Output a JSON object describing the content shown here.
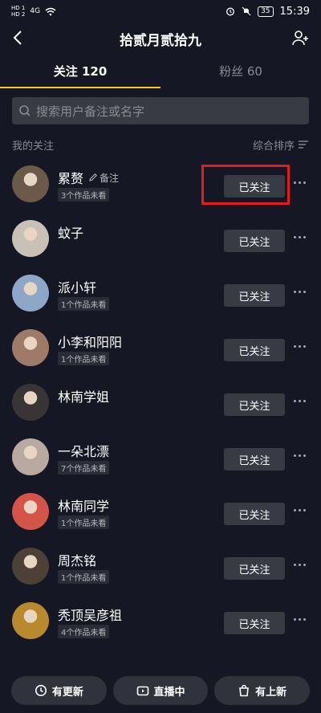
{
  "status_bar": {
    "sim1": "HD 1",
    "sim2": "HD 2",
    "network": "4G",
    "battery": "35",
    "time": "15:39"
  },
  "header": {
    "title": "拾贰月贰拾九"
  },
  "tabs": [
    {
      "label": "关注 120",
      "active": true
    },
    {
      "label": "粉丝 60",
      "active": false
    }
  ],
  "search": {
    "placeholder": "搜索用户备注或名字"
  },
  "section": {
    "title": "我的关注",
    "sort_label": "综合排序"
  },
  "follow_label": "已关注",
  "remark_label": "备注",
  "users": [
    {
      "name": "累赘",
      "badge": "3个作品未看",
      "avatar_color": "#6b5a4a",
      "show_remark": true
    },
    {
      "name": "蚊子",
      "badge": "",
      "avatar_color": "#c9c1b6",
      "show_remark": false
    },
    {
      "name": "派小轩",
      "badge": "1个作品未看",
      "avatar_color": "#8ea6c8",
      "show_remark": false
    },
    {
      "name": "小李和阳阳",
      "badge": "1个作品未看",
      "avatar_color": "#9d7b68",
      "show_remark": false
    },
    {
      "name": "林南学姐",
      "badge": "",
      "avatar_color": "#3a3535",
      "show_remark": false
    },
    {
      "name": "一朵北漂",
      "badge": "7个作品未看",
      "avatar_color": "#b8aaa0",
      "show_remark": false
    },
    {
      "name": "林南同学",
      "badge": "1个作品未看",
      "avatar_color": "#d4544a",
      "show_remark": false
    },
    {
      "name": "周杰铭",
      "badge": "1个作品未看",
      "avatar_color": "#4d4037",
      "show_remark": false
    },
    {
      "name": "秃顶吴彦祖",
      "badge": "4个作品未看",
      "avatar_color": "#b98a2d",
      "show_remark": false
    }
  ],
  "bottom": {
    "updates_label": "有更新",
    "live_label": "直播中",
    "new_label": "有上新"
  },
  "colors": {
    "accent": "#f9c914",
    "highlight": "#e21b1b",
    "background": "#161724"
  }
}
